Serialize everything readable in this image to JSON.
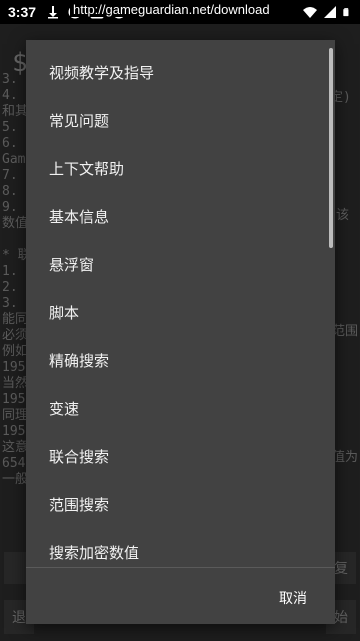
{
  "status_bar": {
    "time": "3:37",
    "icons_left": [
      "download-icon",
      "alert-icon",
      "font-icon",
      "shield-icon"
    ],
    "icons_right": [
      "wifi-icon",
      "signal-icon",
      "battery-icon"
    ]
  },
  "background": {
    "url": "http://gameguardian.net/download",
    "dollar": "$",
    "lines": [
      "3. 特",
      "4. 进",
      "和其",
      "5. 完",
      "6. 返",
      "Gam",
      "7. 搜",
      "8. 如",
      "9. 如",
      "数值",
      "",
      "* 联",
      "1. 从",
      "2. 在",
      "3. 联",
      "能同",
      "必须",
      "例如",
      "195",
      "当然",
      "195",
      "同理",
      "195",
      "这意",
      "654",
      "一般"
    ],
    "right_frags": [
      "定)",
      "该",
      "范围",
      "值为",
      "复",
      "始"
    ],
    "bottom_left": "退"
  },
  "menu": {
    "items": [
      "视频教学及指导",
      "常见问题",
      "上下文帮助",
      "基本信息",
      "悬浮窗",
      "脚本",
      "精确搜索",
      "变速",
      "联合搜索",
      "范围搜索",
      "搜索加密数值"
    ],
    "cancel_label": "取消"
  }
}
